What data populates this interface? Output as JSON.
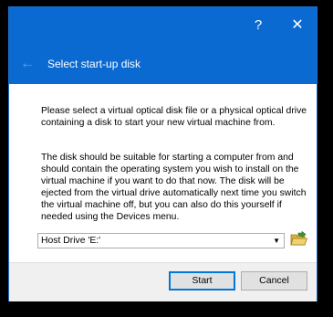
{
  "titlebar": {
    "help_label": "?",
    "close_label": "✕"
  },
  "header": {
    "back_icon": "←",
    "title": "Select start-up disk"
  },
  "content": {
    "paragraph1": "Please select a virtual optical disk file or a physical optical drive containing a disk to start your new virtual machine from.",
    "paragraph2": "The disk should be suitable for starting a computer from and should contain the operating system you wish to install on the virtual machine if you want to do that now. The disk will be ejected from the virtual drive automatically next time you switch the virtual machine off, but you can also do this yourself if needed using the Devices menu.",
    "disk_select": {
      "selected_value": "Host Drive 'E:'",
      "arrow": "▼"
    },
    "folder_icon": "folder-open-icon"
  },
  "buttons": {
    "start_label": "Start",
    "cancel_label": "Cancel"
  },
  "colors": {
    "title_blue": "#0b6ad1",
    "focus_blue": "#0078d7",
    "folder_yellow": "#e8c54a",
    "folder_green": "#3a9a2f"
  }
}
